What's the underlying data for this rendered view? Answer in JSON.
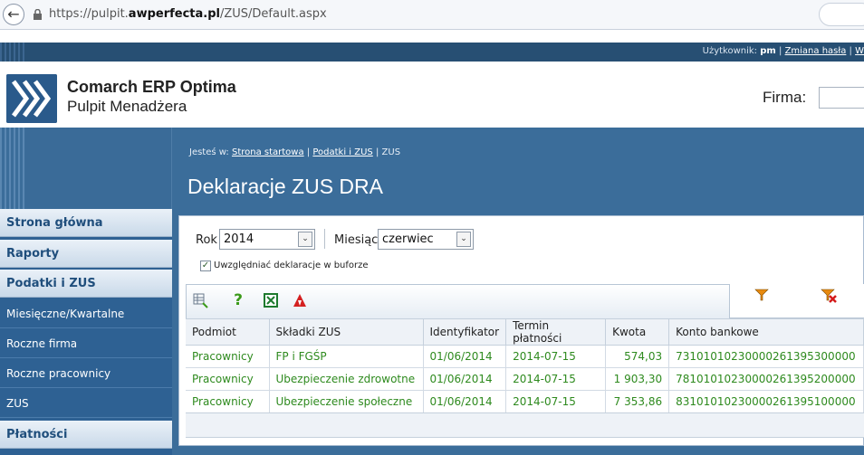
{
  "browser": {
    "url_prefix": "https://pulpit.",
    "url_domain": "awperfecta.pl",
    "url_path": "/ZUS/Default.aspx"
  },
  "user_strip": {
    "user_label": "Użytkownik:",
    "user_name": "pm",
    "change_password": "Zmiana hasła",
    "sep": "|",
    "logout": "W"
  },
  "header": {
    "app_title": "Comarch ERP Optima",
    "app_subtitle": "Pulpit Menadżera",
    "firma_label": "Firma:"
  },
  "breadcrumb": {
    "prefix": "Jesteś w:",
    "home": "Strona startowa",
    "sep": "|",
    "section": "Podatki i ZUS",
    "current": "ZUS"
  },
  "page_title": "Deklaracje ZUS DRA",
  "sidebar": {
    "items": [
      {
        "label": "Strona główna",
        "type": "main"
      },
      {
        "label": "Raporty",
        "type": "main"
      },
      {
        "label": "Podatki i ZUS",
        "type": "main"
      },
      {
        "label": "Miesięczne/Kwartalne",
        "type": "sub"
      },
      {
        "label": "Roczne firma",
        "type": "sub"
      },
      {
        "label": "Roczne pracownicy",
        "type": "sub"
      },
      {
        "label": "ZUS",
        "type": "sub"
      },
      {
        "label": "Płatności",
        "type": "main"
      }
    ]
  },
  "filters": {
    "rok_label": "Rok",
    "rok_value": "2014",
    "miesiac_label": "Miesiąc",
    "miesiac_value": "czerwiec",
    "buffer_label": "Uwzględniać deklaracje w buforze",
    "buffer_checked": true
  },
  "table": {
    "columns": [
      "Podmiot",
      "Składki ZUS",
      "Identyfikator",
      "Termin płatności",
      "Kwota",
      "Konto bankowe"
    ],
    "rows": [
      [
        "Pracownicy",
        "FP i FGŚP",
        "01/06/2014",
        "2014-07-15",
        "574,03",
        "73101010230000261395300000"
      ],
      [
        "Pracownicy",
        "Ubezpieczenie zdrowotne",
        "01/06/2014",
        "2014-07-15",
        "1 903,30",
        "78101010230000261395200000"
      ],
      [
        "Pracownicy",
        "Ubezpieczenie społeczne",
        "01/06/2014",
        "2014-07-15",
        "7 353,86",
        "83101010230000261395100000"
      ]
    ]
  },
  "colors": {
    "primary_blue": "#3b6d9a",
    "sidebar_blue": "#2e6193",
    "data_green": "#2e8a1e"
  }
}
